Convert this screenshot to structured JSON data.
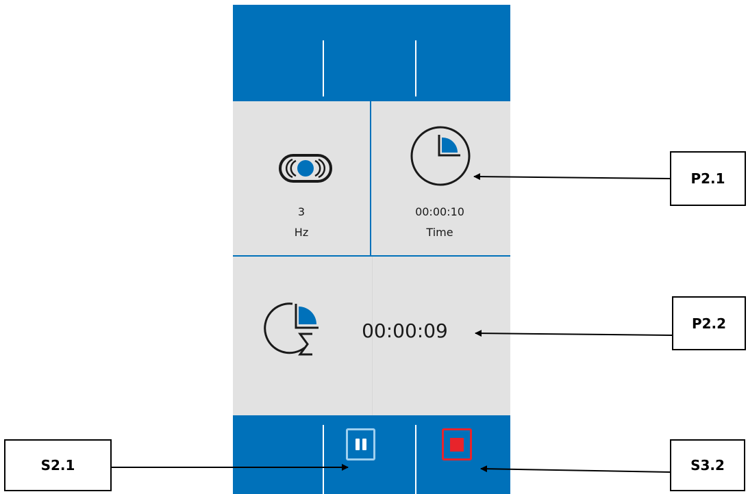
{
  "panels": {
    "frequency": {
      "icon": "vibration-icon",
      "value": "3",
      "unit": "Hz"
    },
    "time": {
      "icon": "clock-icon",
      "value": "00:00:10",
      "label": "Time"
    },
    "total_time": {
      "icon": "clock-sum-icon",
      "value": "00:00:09"
    }
  },
  "buttons": {
    "pause": {
      "icon": "pause-icon"
    },
    "stop": {
      "icon": "stop-icon"
    }
  },
  "callouts": {
    "p21": "P2.1",
    "p22": "P2.2",
    "s21": "S2.1",
    "s32": "S3.2"
  },
  "colors": {
    "bar_blue": "#0071ba",
    "panel_grey": "#e2e2e2",
    "stop_red": "#e8242b",
    "pause_border": "#9fd0ef"
  }
}
